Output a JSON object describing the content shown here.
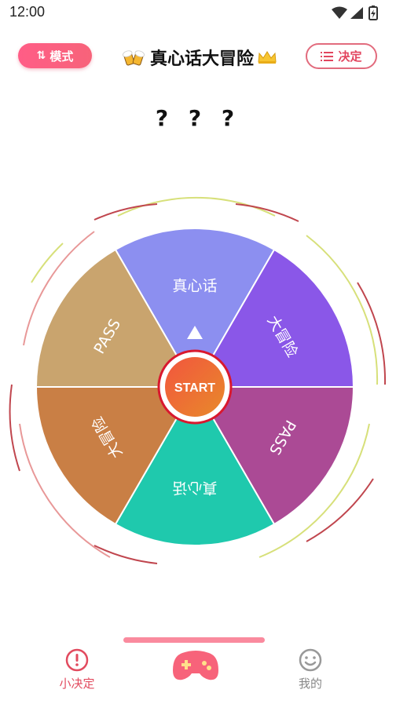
{
  "status_bar": {
    "time": "12:00"
  },
  "header": {
    "mode_label": "模式",
    "mode_icon": "sort-arrows-icon",
    "title": "真心话大冒险",
    "title_emoji": "cheers-beer-icon",
    "title_badge": "crown-icon",
    "decide_label": "决定",
    "decide_icon": "list-icon"
  },
  "result": {
    "text": "? ? ?"
  },
  "wheel": {
    "start_label": "START",
    "segments": [
      {
        "label": "真心话",
        "color": "#8c8ff0"
      },
      {
        "label": "大冒险",
        "color": "#8a57e8"
      },
      {
        "label": "PASS",
        "color": "#ab4a95"
      },
      {
        "label": "真心话",
        "color": "#1fc9ad"
      },
      {
        "label": "大冒险",
        "color": "#c97f45"
      },
      {
        "label": "PASS",
        "color": "#c9a46e"
      }
    ],
    "pointer_color": "#d9182e"
  },
  "bottom_nav": {
    "items": [
      {
        "label": "小决定",
        "icon": "clock-alert-icon",
        "active": true
      },
      {
        "label": "",
        "icon": "gamepad-icon",
        "active": false
      },
      {
        "label": "我的",
        "icon": "smile-face-icon",
        "active": false
      }
    ]
  },
  "colors": {
    "accent": "#f7637a",
    "active_nav": "#e24b5f",
    "inactive_nav": "#888888"
  }
}
